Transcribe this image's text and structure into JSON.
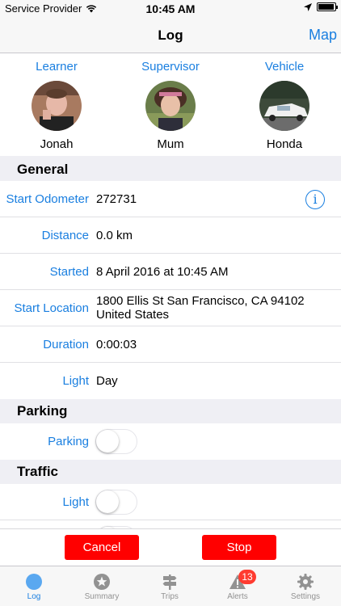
{
  "status_bar": {
    "carrier": "Service Provider",
    "time": "10:45 AM",
    "battery_level": 0.95
  },
  "nav": {
    "title": "Log",
    "right_button": "Map"
  },
  "people": [
    {
      "role": "Learner",
      "name": "Jonah"
    },
    {
      "role": "Supervisor",
      "name": "Mum"
    },
    {
      "role": "Vehicle",
      "name": "Honda"
    }
  ],
  "general": {
    "header": "General",
    "rows": [
      {
        "label": "Start Odometer",
        "value": "272731"
      },
      {
        "label": "Distance",
        "value": "0.0 km"
      },
      {
        "label": "Started",
        "value": "8 April 2016 at 10:45 AM"
      },
      {
        "label": "Start Location",
        "value": "1800 Ellis St San Francisco, CA  94102\nUnited States"
      },
      {
        "label": "Duration",
        "value": "0:00:03"
      },
      {
        "label": "Light",
        "value": "Day"
      }
    ]
  },
  "parking": {
    "header": "Parking",
    "label": "Parking",
    "on": false
  },
  "traffic": {
    "header": "Traffic",
    "label": "Light",
    "on": false
  },
  "actions": {
    "cancel": "Cancel",
    "stop": "Stop"
  },
  "tabs": [
    {
      "label": "Log",
      "icon": "circle-icon",
      "active": true
    },
    {
      "label": "Summary",
      "icon": "star-badge-icon",
      "active": false
    },
    {
      "label": "Trips",
      "icon": "signpost-icon",
      "active": false
    },
    {
      "label": "Alerts",
      "icon": "warning-icon",
      "active": false,
      "badge": "13"
    },
    {
      "label": "Settings",
      "icon": "gear-icon",
      "active": false
    }
  ],
  "colors": {
    "accent": "#1a7fe0",
    "danger": "#ff0000",
    "background": "#efeff4"
  }
}
